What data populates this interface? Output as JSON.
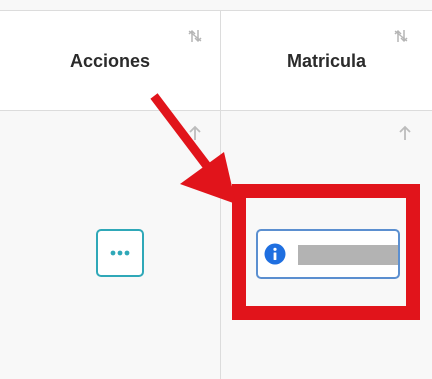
{
  "table": {
    "columns": [
      {
        "label": "Acciones",
        "sort_icon": "sort-updown-icon"
      },
      {
        "label": "Matricula",
        "sort_icon": "sort-updown-icon"
      }
    ],
    "row": {
      "acciones_icon": "more-horizontal-icon",
      "matricula_icon": "info-icon",
      "matricula_value_redacted": true,
      "sort_indicator": "arrow-up-icon"
    }
  },
  "annotation": {
    "arrow_color": "#e1141b",
    "highlight_color": "#e1141b"
  },
  "colors": {
    "more_button_border": "#2fa8b8",
    "field_border": "#5b8fd0",
    "info_icon": "#1f6fe0",
    "redaction": "#b3b3b3"
  }
}
